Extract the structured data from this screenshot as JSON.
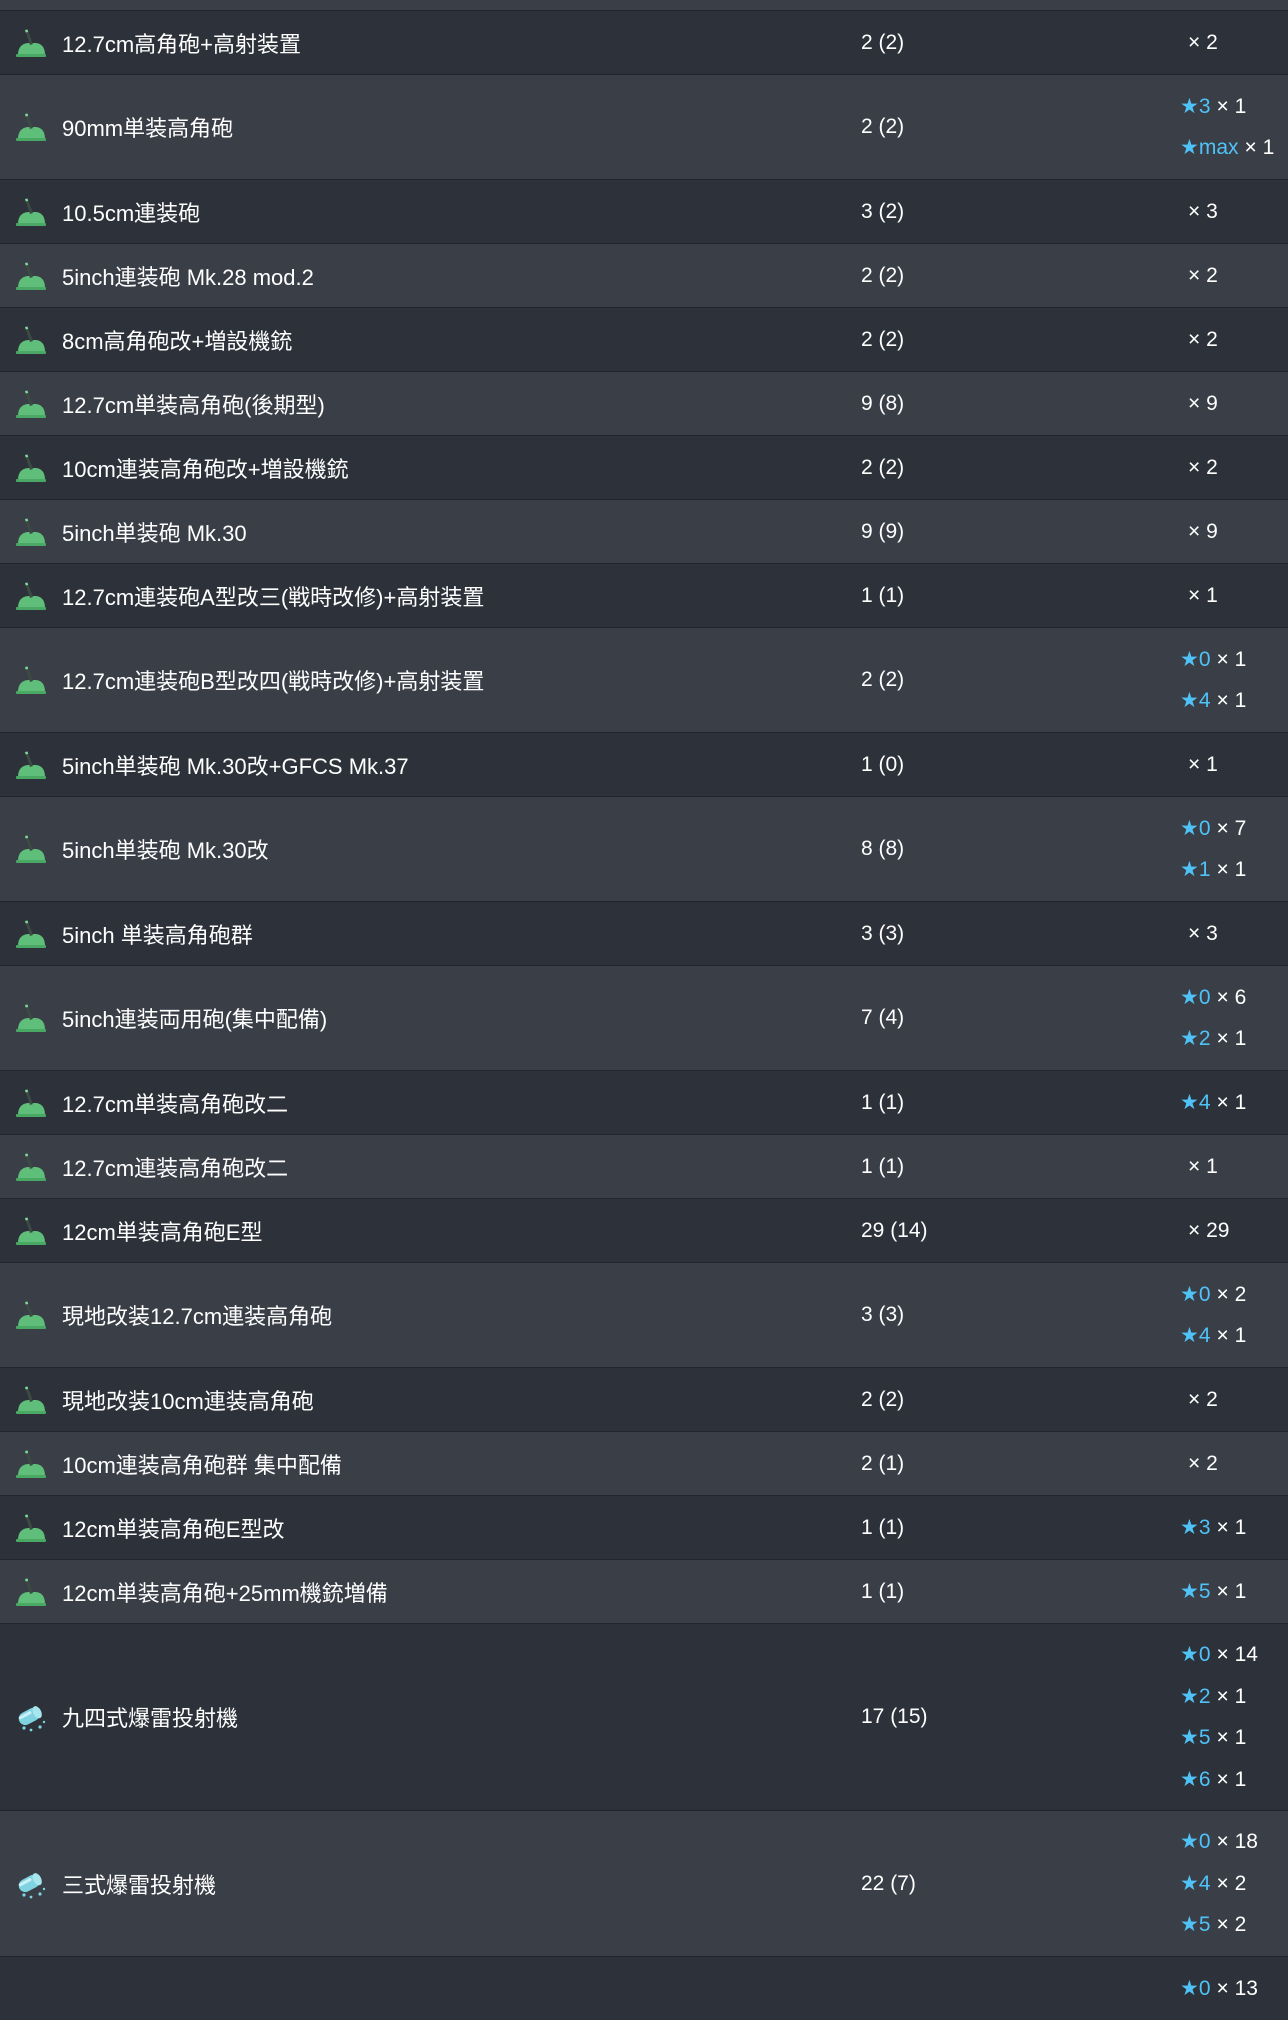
{
  "colors": {
    "row_dark": "#2d3139",
    "row_light": "#3a3e47",
    "star": "#4fc3f7",
    "gun_icon": "#5fbf7a",
    "depth_charge_icon": "#7fd3e0"
  },
  "rows": [
    {
      "icon": "gun-icon",
      "name": "12.7cm高角砲+高射装置",
      "count": "2 (2)",
      "levels": [
        {
          "star": "",
          "mult": "× 2"
        }
      ]
    },
    {
      "icon": "gun-icon",
      "name": "90mm単装高角砲",
      "count": "2 (2)",
      "levels": [
        {
          "star": "★3",
          "mult": "× 1"
        },
        {
          "star": "★max",
          "mult": "× 1"
        }
      ]
    },
    {
      "icon": "gun-icon",
      "name": "10.5cm連装砲",
      "count": "3 (2)",
      "levels": [
        {
          "star": "",
          "mult": "× 3"
        }
      ]
    },
    {
      "icon": "gun-icon",
      "name": "5inch連装砲 Mk.28 mod.2",
      "count": "2 (2)",
      "levels": [
        {
          "star": "",
          "mult": "× 2"
        }
      ]
    },
    {
      "icon": "gun-icon",
      "name": "8cm高角砲改+増設機銃",
      "count": "2 (2)",
      "levels": [
        {
          "star": "",
          "mult": "× 2"
        }
      ]
    },
    {
      "icon": "gun-icon",
      "name": "12.7cm単装高角砲(後期型)",
      "count": "9 (8)",
      "levels": [
        {
          "star": "",
          "mult": "× 9"
        }
      ]
    },
    {
      "icon": "gun-icon",
      "name": "10cm連装高角砲改+増設機銃",
      "count": "2 (2)",
      "levels": [
        {
          "star": "",
          "mult": "× 2"
        }
      ]
    },
    {
      "icon": "gun-icon",
      "name": "5inch単装砲 Mk.30",
      "count": "9 (9)",
      "levels": [
        {
          "star": "",
          "mult": "× 9"
        }
      ]
    },
    {
      "icon": "gun-icon",
      "name": "12.7cm連装砲A型改三(戦時改修)+高射装置",
      "count": "1 (1)",
      "levels": [
        {
          "star": "",
          "mult": "× 1"
        }
      ]
    },
    {
      "icon": "gun-icon",
      "name": "12.7cm連装砲B型改四(戦時改修)+高射装置",
      "count": "2 (2)",
      "levels": [
        {
          "star": "★0",
          "mult": "× 1"
        },
        {
          "star": "★4",
          "mult": "× 1"
        }
      ]
    },
    {
      "icon": "gun-icon",
      "name": "5inch単装砲 Mk.30改+GFCS Mk.37",
      "count": "1 (0)",
      "levels": [
        {
          "star": "",
          "mult": "× 1"
        }
      ]
    },
    {
      "icon": "gun-icon",
      "name": "5inch単装砲 Mk.30改",
      "count": "8 (8)",
      "levels": [
        {
          "star": "★0",
          "mult": "× 7"
        },
        {
          "star": "★1",
          "mult": "× 1"
        }
      ]
    },
    {
      "icon": "gun-icon",
      "name": "5inch 単装高角砲群",
      "count": "3 (3)",
      "levels": [
        {
          "star": "",
          "mult": "× 3"
        }
      ]
    },
    {
      "icon": "gun-icon",
      "name": "5inch連装両用砲(集中配備)",
      "count": "7 (4)",
      "levels": [
        {
          "star": "★0",
          "mult": "× 6"
        },
        {
          "star": "★2",
          "mult": "× 1"
        }
      ]
    },
    {
      "icon": "gun-icon",
      "name": "12.7cm単装高角砲改二",
      "count": "1 (1)",
      "levels": [
        {
          "star": "★4",
          "mult": "× 1"
        }
      ]
    },
    {
      "icon": "gun-icon",
      "name": "12.7cm連装高角砲改二",
      "count": "1 (1)",
      "levels": [
        {
          "star": "",
          "mult": "× 1"
        }
      ]
    },
    {
      "icon": "gun-icon",
      "name": "12cm単装高角砲E型",
      "count": "29 (14)",
      "levels": [
        {
          "star": "",
          "mult": "× 29"
        }
      ]
    },
    {
      "icon": "gun-icon",
      "name": "現地改装12.7cm連装高角砲",
      "count": "3 (3)",
      "levels": [
        {
          "star": "★0",
          "mult": "× 2"
        },
        {
          "star": "★4",
          "mult": "× 1"
        }
      ]
    },
    {
      "icon": "gun-icon",
      "name": "現地改装10cm連装高角砲",
      "count": "2 (2)",
      "levels": [
        {
          "star": "",
          "mult": "× 2"
        }
      ]
    },
    {
      "icon": "gun-icon",
      "name": "10cm連装高角砲群 集中配備",
      "count": "2 (1)",
      "levels": [
        {
          "star": "",
          "mult": "× 2"
        }
      ]
    },
    {
      "icon": "gun-icon",
      "name": "12cm単装高角砲E型改",
      "count": "1 (1)",
      "levels": [
        {
          "star": "★3",
          "mult": "× 1"
        }
      ]
    },
    {
      "icon": "gun-icon",
      "name": "12cm単装高角砲+25mm機銃増備",
      "count": "1 (1)",
      "levels": [
        {
          "star": "★5",
          "mult": "× 1"
        }
      ]
    },
    {
      "icon": "depth-charge-icon",
      "name": "九四式爆雷投射機",
      "count": "17 (15)",
      "levels": [
        {
          "star": "★0",
          "mult": "× 14"
        },
        {
          "star": "★2",
          "mult": "× 1"
        },
        {
          "star": "★5",
          "mult": "× 1"
        },
        {
          "star": "★6",
          "mult": "× 1"
        }
      ]
    },
    {
      "icon": "depth-charge-icon",
      "name": "三式爆雷投射機",
      "count": "22 (7)",
      "levels": [
        {
          "star": "★0",
          "mult": "× 18"
        },
        {
          "star": "★4",
          "mult": "× 2"
        },
        {
          "star": "★5",
          "mult": "× 2"
        }
      ]
    },
    {
      "icon": "",
      "name": "",
      "count": "",
      "levels": [
        {
          "star": "★0",
          "mult": "× 13"
        }
      ]
    }
  ]
}
